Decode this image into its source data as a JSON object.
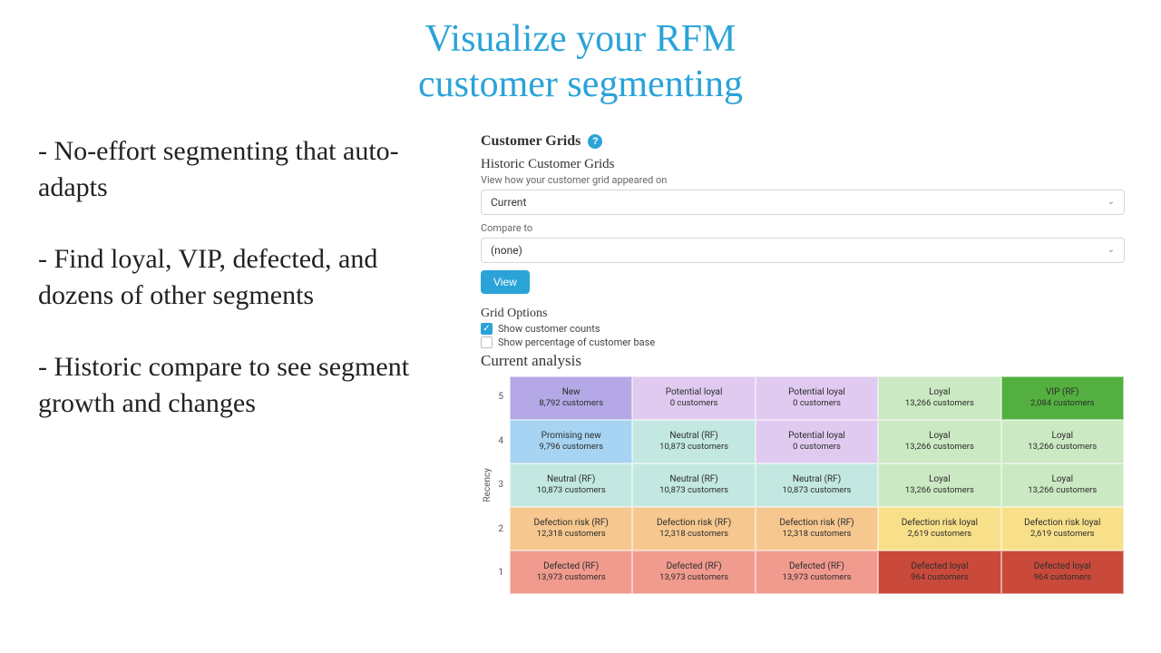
{
  "headline_line1": "Visualize your RFM",
  "headline_line2": "customer segmenting",
  "bullets": {
    "b1": "- No-effort segmenting that auto-adapts",
    "b2": "- Find loyal, VIP, defected, and dozens of other segments",
    "b3": "- Historic compare to see segment growth and changes"
  },
  "panel": {
    "title": "Customer Grids",
    "historic_title": "Historic Customer Grids",
    "historic_helper": "View how your customer grid appeared on",
    "date_select_value": "Current",
    "compare_label": "Compare to",
    "compare_value": "(none)",
    "view_btn": "View",
    "options_title": "Grid Options",
    "opt_counts": "Show customer counts",
    "opt_percent": "Show percentage of customer base",
    "analysis_title": "Current analysis",
    "y_axis_label": "Recency",
    "y_ticks": [
      "5",
      "4",
      "3",
      "2",
      "1"
    ]
  },
  "grid": {
    "rows": [
      [
        {
          "name": "New",
          "count": "8,792 customers",
          "color": "#b4a8e6"
        },
        {
          "name": "Potential loyal",
          "count": "0 customers",
          "color": "#e0caf0"
        },
        {
          "name": "Potential loyal",
          "count": "0 customers",
          "color": "#e0caf0"
        },
        {
          "name": "Loyal",
          "count": "13,266 customers",
          "color": "#cbe9c2"
        },
        {
          "name": "VIP (RF)",
          "count": "2,084 customers",
          "color": "#53b040"
        }
      ],
      [
        {
          "name": "Promising new",
          "count": "9,796 customers",
          "color": "#a6d4f2"
        },
        {
          "name": "Neutral (RF)",
          "count": "10,873 customers",
          "color": "#c2e8e1"
        },
        {
          "name": "Potential loyal",
          "count": "0 customers",
          "color": "#e0caf0"
        },
        {
          "name": "Loyal",
          "count": "13,266 customers",
          "color": "#cbe9c2"
        },
        {
          "name": "Loyal",
          "count": "13,266 customers",
          "color": "#cbe9c2"
        }
      ],
      [
        {
          "name": "Neutral (RF)",
          "count": "10,873 customers",
          "color": "#c2e8e1"
        },
        {
          "name": "Neutral (RF)",
          "count": "10,873 customers",
          "color": "#c2e8e1"
        },
        {
          "name": "Neutral (RF)",
          "count": "10,873 customers",
          "color": "#c2e8e1"
        },
        {
          "name": "Loyal",
          "count": "13,266 customers",
          "color": "#cbe9c2"
        },
        {
          "name": "Loyal",
          "count": "13,266 customers",
          "color": "#cbe9c2"
        }
      ],
      [
        {
          "name": "Defection risk (RF)",
          "count": "12,318 customers",
          "color": "#f6c78f"
        },
        {
          "name": "Defection risk (RF)",
          "count": "12,318 customers",
          "color": "#f6c78f"
        },
        {
          "name": "Defection risk (RF)",
          "count": "12,318 customers",
          "color": "#f6c78f"
        },
        {
          "name": "Defection risk loyal",
          "count": "2,619 customers",
          "color": "#f8e08a"
        },
        {
          "name": "Defection risk loyal",
          "count": "2,619 customers",
          "color": "#f8e08a"
        }
      ],
      [
        {
          "name": "Defected (RF)",
          "count": "13,973 customers",
          "color": "#f19a8e"
        },
        {
          "name": "Defected (RF)",
          "count": "13,973 customers",
          "color": "#f19a8e"
        },
        {
          "name": "Defected (RF)",
          "count": "13,973 customers",
          "color": "#f19a8e"
        },
        {
          "name": "Defected loyal",
          "count": "964 customers",
          "color": "#c94a3b"
        },
        {
          "name": "Defected loyal",
          "count": "964 customers",
          "color": "#c94a3b"
        }
      ]
    ]
  }
}
